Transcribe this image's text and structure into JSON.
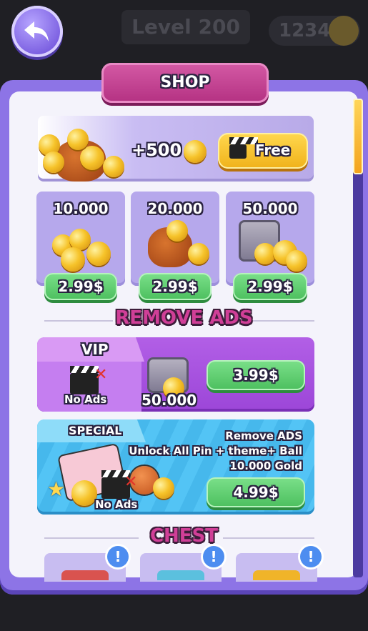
{
  "hud": {
    "level_label": "Level 200",
    "coins": "12345"
  },
  "shop": {
    "title": "SHOP",
    "free_offer": {
      "amount": "+500",
      "button_label": "Free"
    },
    "packs": [
      {
        "amount": "10.000",
        "price": "2.99$",
        "art": "coin-stack"
      },
      {
        "amount": "20.000",
        "price": "2.99$",
        "art": "coin-bag"
      },
      {
        "amount": "50.000",
        "price": "2.99$",
        "art": "coin-safe"
      }
    ],
    "remove_ads_title": "REMOVE ADS",
    "vip": {
      "tag": "VIP",
      "no_ads_label": "No Ads",
      "bonus_amount": "50.000",
      "price": "3.99$"
    },
    "special": {
      "tag": "SPECIAL",
      "line1": "Remove ADS",
      "line2": "Unlock All Pin + theme+ Ball",
      "line3": "10.000 Gold",
      "no_ads_label": "No Ads",
      "price": "4.99$"
    },
    "chest_title": "CHEST",
    "chests": [
      {
        "alert": "!",
        "color": "#d9534f"
      },
      {
        "alert": "!",
        "color": "#5bc0de"
      },
      {
        "alert": "!",
        "color": "#f0b429"
      }
    ]
  }
}
